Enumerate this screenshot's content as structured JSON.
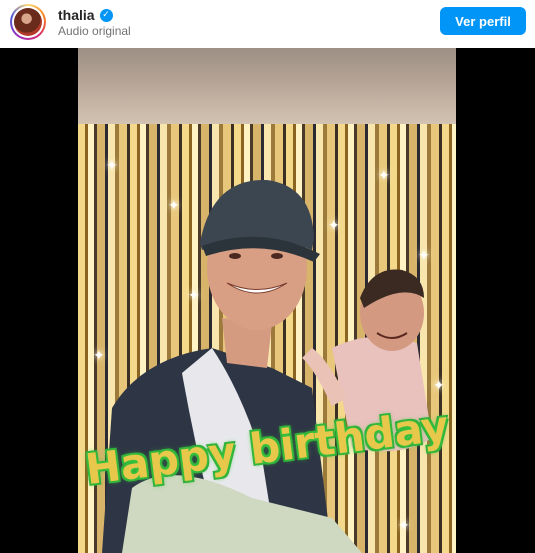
{
  "header": {
    "username": "thalia",
    "verified_icon": "verified-badge-icon",
    "subtitle": "Audio original",
    "view_profile_label": "Ver perfil",
    "accent_color": "#0095f6"
  },
  "video": {
    "overlay_text": "Happy birthday"
  }
}
